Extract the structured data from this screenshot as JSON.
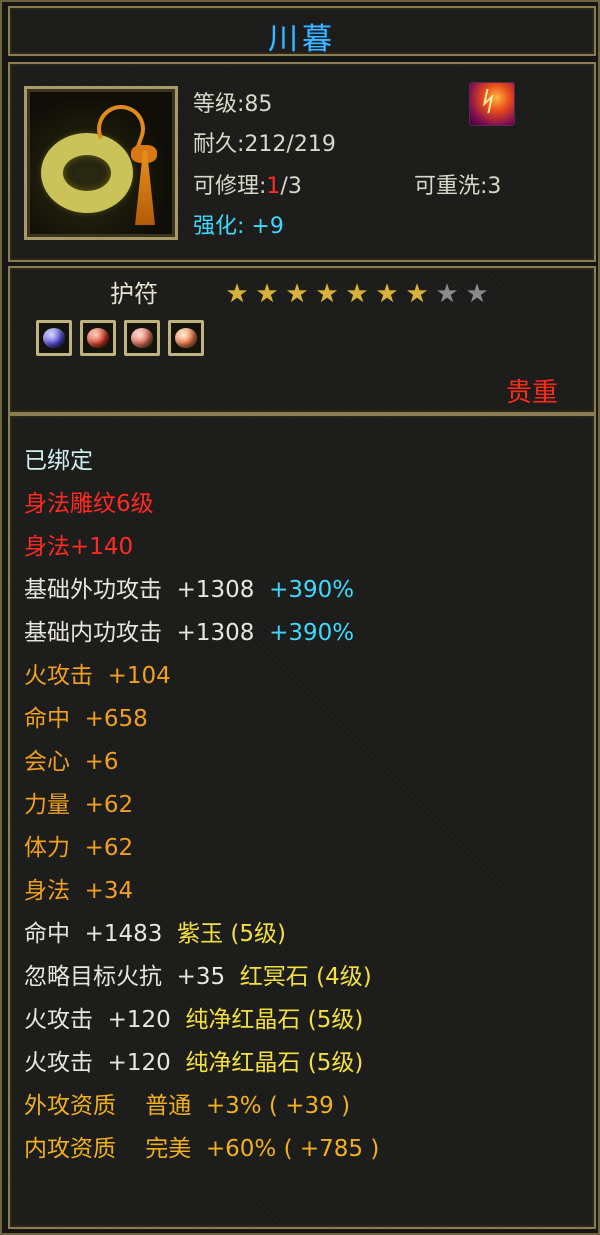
{
  "title": "川暮",
  "item": {
    "icon": "jade-pendant-icon",
    "level_label": "等级:",
    "level_value": "85",
    "durability_label": "耐久:",
    "durability_value": "212/219",
    "repair_label": "可修理:",
    "repair_used": "1",
    "repair_total": "/3",
    "rewash_label": "可重洗:",
    "rewash_value": "3",
    "enhance_label": "强化:",
    "enhance_value": "+9"
  },
  "category": {
    "label": "护符",
    "stars_total": 9,
    "stars_filled": 7,
    "gems": [
      "blue-gem-icon",
      "red-gem-icon",
      "red-gem-icon",
      "red-gem-icon"
    ],
    "rarity": "贵重"
  },
  "attributes": [
    {
      "parts": [
        {
          "text": "已绑定",
          "color": "cyanw"
        }
      ]
    },
    {
      "parts": [
        {
          "text": "身法雕纹6级",
          "color": "red"
        }
      ]
    },
    {
      "parts": [
        {
          "text": "身法+140",
          "color": "red"
        }
      ]
    },
    {
      "parts": [
        {
          "text": "基础外功攻击  +1308  ",
          "color": "white"
        },
        {
          "text": "+390%",
          "color": "cyan"
        }
      ]
    },
    {
      "parts": [
        {
          "text": "基础内功攻击  +1308  ",
          "color": "white"
        },
        {
          "text": "+390%",
          "color": "cyan"
        }
      ]
    },
    {
      "parts": [
        {
          "text": "火攻击  +104",
          "color": "orange"
        }
      ]
    },
    {
      "parts": [
        {
          "text": "命中  +658",
          "color": "orange"
        }
      ]
    },
    {
      "parts": [
        {
          "text": "会心  +6",
          "color": "orange"
        }
      ]
    },
    {
      "parts": [
        {
          "text": "力量  +62",
          "color": "orange"
        }
      ]
    },
    {
      "parts": [
        {
          "text": "体力  +62",
          "color": "orange"
        }
      ]
    },
    {
      "parts": [
        {
          "text": "身法  +34",
          "color": "orange"
        }
      ]
    },
    {
      "parts": [
        {
          "text": "命中  +1483  ",
          "color": "white"
        },
        {
          "text": "紫玉 (5级)",
          "color": "yellow"
        }
      ]
    },
    {
      "parts": [
        {
          "text": "忽略目标火抗  +35  ",
          "color": "white"
        },
        {
          "text": "红冥石 (4级)",
          "color": "yellow"
        }
      ]
    },
    {
      "parts": [
        {
          "text": "火攻击  +120  ",
          "color": "white"
        },
        {
          "text": "纯净红晶石 (5级)",
          "color": "yellow"
        }
      ]
    },
    {
      "parts": [
        {
          "text": "火攻击  +120  ",
          "color": "white"
        },
        {
          "text": "纯净红晶石 (5级)",
          "color": "yellow"
        }
      ]
    },
    {
      "parts": [
        {
          "text": "外攻资质    普通  +3% ( +39 )",
          "color": "gold"
        }
      ]
    },
    {
      "parts": [
        {
          "text": "内攻资质    完美  +60% ( +785 )",
          "color": "gold"
        }
      ]
    }
  ],
  "colors": {
    "title": "#3fb6ff",
    "enhance": "#3fd8ff",
    "rarity": "#ff2a1a",
    "star_on": "#d8b23c",
    "star_off": "#8a8a8a"
  }
}
